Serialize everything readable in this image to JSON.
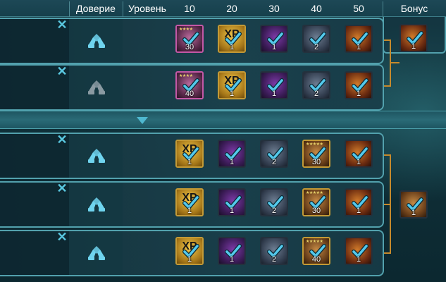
{
  "header": {
    "trust_label": "Доверие",
    "level_label": "Уровень",
    "levels": [
      "10",
      "20",
      "30",
      "40",
      "50"
    ],
    "bonus_label": "Бонус"
  },
  "separator": {
    "icon": "chevron-down-icon"
  },
  "rows": [
    {
      "trust_active": true,
      "items": [
        {
          "type": "champion",
          "stars": "★★★★",
          "count": "30",
          "claimed": true
        },
        {
          "type": "xp-brew",
          "label": "XP",
          "count": "1",
          "claimed": true
        },
        {
          "type": "potion",
          "count": "1",
          "claimed": true
        },
        {
          "type": "tome",
          "count": "2",
          "claimed": true
        },
        {
          "type": "fire-shard",
          "count": "1",
          "claimed": true
        }
      ]
    },
    {
      "trust_active": false,
      "items": [
        {
          "type": "champion",
          "stars": "★★★★",
          "count": "40",
          "claimed": true
        },
        {
          "type": "xp-brew",
          "label": "XP",
          "count": "1",
          "claimed": true
        },
        {
          "type": "potion",
          "count": "1",
          "claimed": true
        },
        {
          "type": "tome",
          "count": "2",
          "claimed": true
        },
        {
          "type": "fire-shard",
          "count": "1",
          "claimed": true
        }
      ]
    },
    {
      "trust_active": true,
      "items": [
        {
          "type": "xp-brew",
          "label": "XP",
          "count": "1",
          "claimed": true
        },
        {
          "type": "potion",
          "count": "1",
          "claimed": true
        },
        {
          "type": "tome",
          "count": "2",
          "claimed": true
        },
        {
          "type": "champion-gold",
          "stars": "★★★★★",
          "count": "30",
          "claimed": true
        },
        {
          "type": "fire-shard",
          "count": "1",
          "claimed": true
        }
      ]
    },
    {
      "trust_active": true,
      "items": [
        {
          "type": "xp-brew",
          "label": "XP",
          "count": "1",
          "claimed": true
        },
        {
          "type": "potion",
          "count": "1",
          "claimed": true
        },
        {
          "type": "tome",
          "count": "2",
          "claimed": true
        },
        {
          "type": "champion-gold",
          "stars": "★★★★★",
          "count": "30",
          "claimed": true
        },
        {
          "type": "fire-shard",
          "count": "1",
          "claimed": true
        }
      ]
    },
    {
      "trust_active": true,
      "items": [
        {
          "type": "xp-brew",
          "label": "XP",
          "count": "1",
          "claimed": true
        },
        {
          "type": "potion",
          "count": "1",
          "claimed": true
        },
        {
          "type": "tome",
          "count": "2",
          "claimed": true
        },
        {
          "type": "champion-gold",
          "stars": "★★★★★",
          "count": "40",
          "claimed": true
        },
        {
          "type": "fire-shard",
          "count": "1",
          "claimed": true
        }
      ]
    }
  ],
  "bonuses": [
    {
      "type": "fire-shard",
      "count": "1",
      "claimed": true
    },
    {
      "type": "champion-bonus",
      "count": "1",
      "claimed": true
    }
  ],
  "colors": {
    "accent": "#5ac8e0",
    "check": "#54c9ec",
    "connector": "#c78a2c",
    "row_border": "#52a1ad"
  }
}
